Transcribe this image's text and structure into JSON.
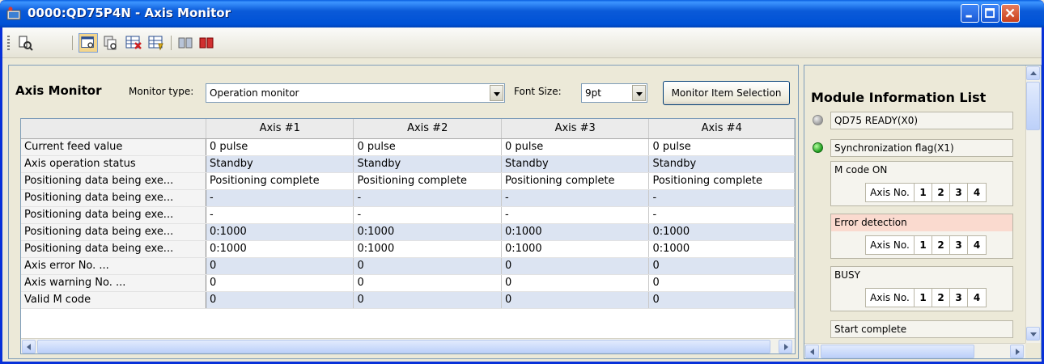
{
  "window": {
    "title": "0000:QD75P4N - Axis Monitor"
  },
  "toolbar": {
    "icons": [
      "monitor-icon",
      "axis-monitor-icon",
      "history-icon",
      "error-reset-icon",
      "table-icon",
      "servo-icon",
      "stop-icon"
    ]
  },
  "axis_monitor": {
    "title": "Axis Monitor",
    "monitor_type_label": "Monitor type:",
    "monitor_type_value": "Operation monitor",
    "font_size_label": "Font Size:",
    "font_size_value": "9pt",
    "monitor_item_selection": "Monitor Item Selection",
    "columns": [
      "Axis #1",
      "Axis #2",
      "Axis #3",
      "Axis #4"
    ],
    "rows": [
      {
        "label": "Current feed value",
        "values": [
          "0 pulse",
          "0 pulse",
          "0 pulse",
          "0 pulse"
        ]
      },
      {
        "label": "Axis operation status",
        "values": [
          "Standby",
          "Standby",
          "Standby",
          "Standby"
        ]
      },
      {
        "label": "Positioning data being exe...",
        "values": [
          "Positioning complete",
          "Positioning complete",
          "Positioning complete",
          "Positioning complete"
        ]
      },
      {
        "label": "Positioning data being exe...",
        "values": [
          "-",
          "-",
          "-",
          "-"
        ]
      },
      {
        "label": "Positioning data being exe...",
        "values": [
          "-",
          "-",
          "-",
          "-"
        ]
      },
      {
        "label": "Positioning data being exe...",
        "values": [
          "0:1000",
          "0:1000",
          "0:1000",
          "0:1000"
        ]
      },
      {
        "label": "Positioning data being exe...",
        "values": [
          "0:1000",
          "0:1000",
          "0:1000",
          "0:1000"
        ]
      },
      {
        "label": "Axis error No. ...",
        "values": [
          "0",
          "0",
          "0",
          "0"
        ]
      },
      {
        "label": "Axis warning No. ...",
        "values": [
          "0",
          "0",
          "0",
          "0"
        ]
      },
      {
        "label": "Valid M code",
        "values": [
          "0",
          "0",
          "0",
          "0"
        ]
      }
    ]
  },
  "module_info": {
    "title": "Module Information List",
    "items": [
      {
        "label": "QD75 READY(X0)",
        "led": "off"
      },
      {
        "label": "Synchronization flag(X1)",
        "led": "on"
      }
    ],
    "groups": [
      {
        "label": "M code ON",
        "error": false
      },
      {
        "label": "Error detection",
        "error": true
      },
      {
        "label": "BUSY",
        "error": false
      }
    ],
    "axis_no_label": "Axis No.",
    "axis_numbers": [
      "1",
      "2",
      "3",
      "4"
    ],
    "last_item": "Start complete"
  },
  "colors": {
    "title_bar": "#0054e3",
    "row_alt": "#dce4f2",
    "error_highlight": "#fadacf",
    "led_on": "#1c9a1c"
  }
}
